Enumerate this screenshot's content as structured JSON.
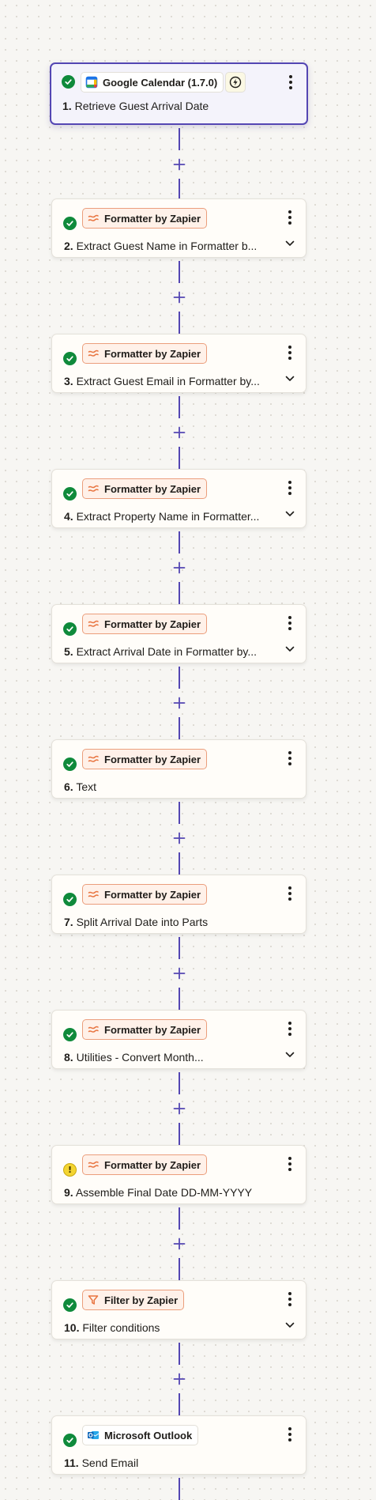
{
  "colors": {
    "accent": "#5446b3",
    "success": "#0f8a3b",
    "warning": "#f3d431",
    "formatter_orange": "#e8743f"
  },
  "steps": [
    {
      "number": "1.",
      "app": "Google Calendar (1.7.0)",
      "app_icon": "google-calendar-icon",
      "title": "Retrieve Guest Arrival Date",
      "status": "success",
      "selected": true,
      "trigger_icon": "lightning-bolt-icon",
      "expandable": false
    },
    {
      "number": "2.",
      "app": "Formatter by Zapier",
      "app_icon": "formatter-icon",
      "title": "Extract Guest Name in Formatter b...",
      "status": "success",
      "expandable": true
    },
    {
      "number": "3.",
      "app": "Formatter by Zapier",
      "app_icon": "formatter-icon",
      "title": "Extract Guest Email in Formatter by...",
      "status": "success",
      "expandable": true
    },
    {
      "number": "4.",
      "app": "Formatter by Zapier",
      "app_icon": "formatter-icon",
      "title": "Extract Property Name in Formatter...",
      "status": "success",
      "expandable": true
    },
    {
      "number": "5.",
      "app": "Formatter by Zapier",
      "app_icon": "formatter-icon",
      "title": "Extract Arrival Date in Formatter by...",
      "status": "success",
      "expandable": true
    },
    {
      "number": "6.",
      "app": "Formatter by Zapier",
      "app_icon": "formatter-icon",
      "title": "Text",
      "status": "success",
      "expandable": false
    },
    {
      "number": "7.",
      "app": "Formatter by Zapier",
      "app_icon": "formatter-icon",
      "title": "Split Arrival Date into Parts",
      "status": "success",
      "expandable": false
    },
    {
      "number": "8.",
      "app": "Formatter by Zapier",
      "app_icon": "formatter-icon",
      "title": "Utilities - Convert Month...",
      "status": "success",
      "expandable": true
    },
    {
      "number": "9.",
      "app": "Formatter by Zapier",
      "app_icon": "formatter-icon",
      "title": "Assemble Final Date DD-MM-YYYY",
      "status": "warning",
      "expandable": false
    },
    {
      "number": "10.",
      "app": "Filter by Zapier",
      "app_icon": "filter-icon",
      "title": "Filter conditions",
      "status": "success",
      "expandable": true
    },
    {
      "number": "11.",
      "app": "Microsoft Outlook",
      "app_icon": "outlook-icon",
      "title": "Send Email",
      "status": "success",
      "expandable": false
    }
  ]
}
